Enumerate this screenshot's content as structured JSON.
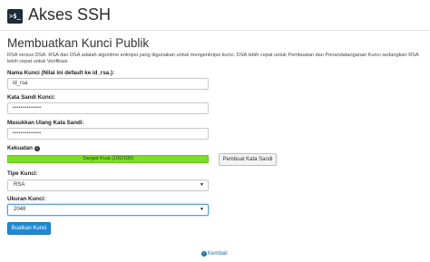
{
  "header": {
    "icon_text": ">$_",
    "title": "Akses SSH"
  },
  "section": {
    "title": "Membuatkan Kunci Publik",
    "description": "RSA versus DSA: RSA dan DSA adalah algoritme enkripsi yang digunakan untuk mengenkripsi kunci. DSA lebih cepat untuk Pembuatan dan Penandatanganan Kunci sedangkan RSA lebih cepat untuk Verifikasi."
  },
  "form": {
    "key_name_label": "Nama Kunci (Nilai ini default ke id_rsa.):",
    "key_name_value": "id_rsa",
    "password_label": "Kata Sandi Kunci:",
    "password_value": "••••••••••••••",
    "password_confirm_label": "Masukkan Ulang Kata Sandi:",
    "password_confirm_value": "••••••••••••••",
    "strength_label": "Kekuatan",
    "strength_text": "Sangat Kuat (100/100)",
    "strength_value": 100,
    "generate_password_button": "Pembuat Kata Sandi",
    "key_type_label": "Tipe Kunci:",
    "key_type_value": "RSA",
    "key_size_label": "Ukuran Kunci:",
    "key_size_value": "2048",
    "submit_button": "Buatkan Kunci"
  },
  "footer": {
    "back_link": "Kembali"
  },
  "colors": {
    "accent": "#1f8ad4",
    "strength_fill": "#7dde26",
    "link": "#1f6fae"
  },
  "icons": {
    "info": "info-icon",
    "back": "back-arrow-icon",
    "dropdown": "caret-down-icon"
  }
}
